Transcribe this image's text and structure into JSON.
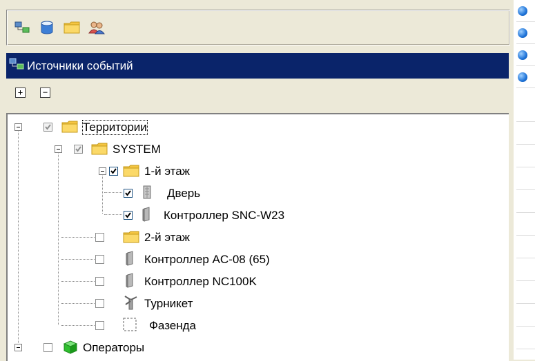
{
  "panel_title": "Источники событий",
  "toolbar": {
    "buttons": [
      {
        "icon": "network-sources-icon"
      },
      {
        "icon": "database-icon"
      },
      {
        "icon": "folder-icon"
      },
      {
        "icon": "users-icon"
      }
    ]
  },
  "expand_buttons": {
    "expand_all": "+",
    "collapse_all": "−"
  },
  "tree": {
    "territories": "Территории",
    "system": "SYSTEM",
    "floor1": "1-й этаж",
    "door": "Дверь",
    "controller_snc": "Контроллер SNC-W23",
    "floor2": "2-й этаж",
    "controller_ac": "Контроллер AC-08 (65)",
    "controller_nc": "Контроллер NC100K",
    "turnstile": "Турникет",
    "fazenda": "Фазенда",
    "operators": "Операторы"
  },
  "colors": {
    "title_bg": "#0a246a",
    "window_bg": "#ece9d8",
    "folder": "#f5c542"
  }
}
